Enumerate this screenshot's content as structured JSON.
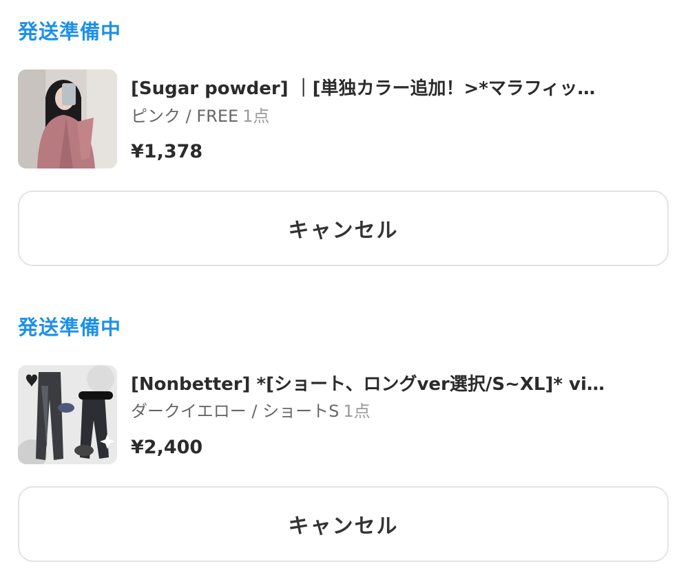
{
  "orders": [
    {
      "status": "発送準備中",
      "title": "[Sugar powder] ｜[単独カラー追加！>*マラフィッ…",
      "variant": "ピンク / FREE",
      "quantity": "1点",
      "price": "¥1,378",
      "cancel_label": "キャンセル"
    },
    {
      "status": "発送準備中",
      "title": "[Nonbetter] *[ショート、ロングver選択/S~XL]* vi…",
      "variant": "ダークイエロー / ショートS",
      "quantity": "1点",
      "price": "¥2,400",
      "cancel_label": "キャンセル"
    }
  ],
  "colors": {
    "status": "#1e90e8",
    "text": "#2b2b2b",
    "subtext": "#666666",
    "border": "#e2e2e2"
  }
}
